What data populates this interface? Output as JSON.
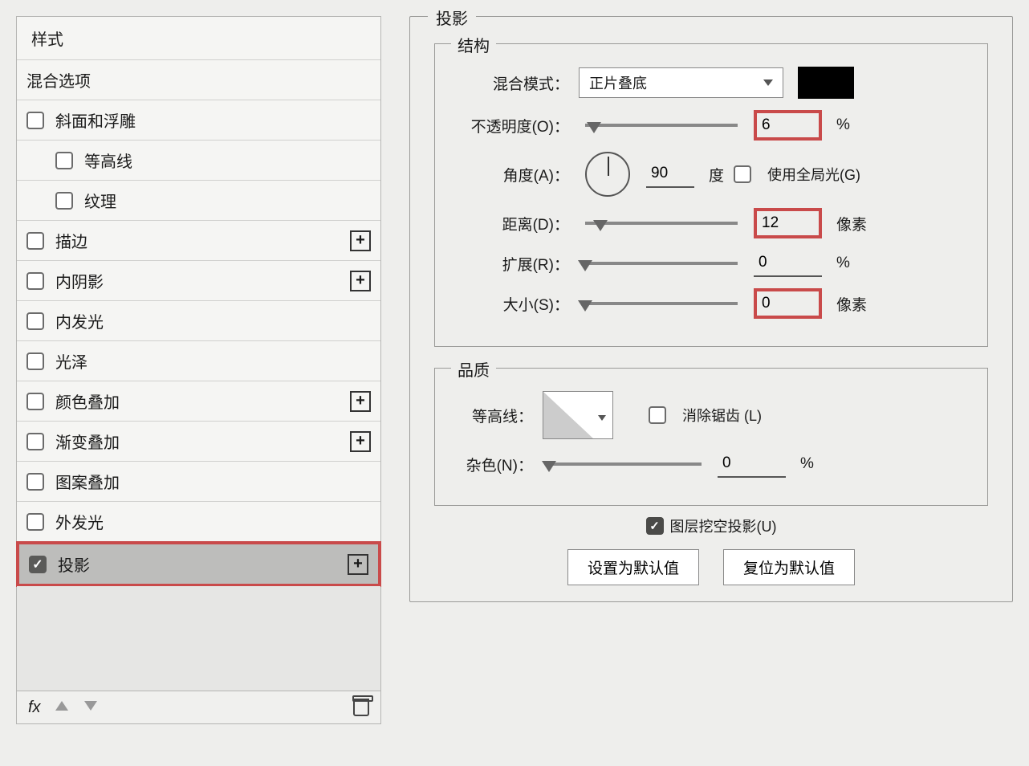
{
  "left": {
    "header": "样式",
    "blending_options": "混合选项",
    "items": [
      {
        "label": "斜面和浮雕",
        "checked": false,
        "hasPlus": false
      },
      {
        "label": "等高线",
        "checked": false,
        "hasPlus": false,
        "indent": true
      },
      {
        "label": "纹理",
        "checked": false,
        "hasPlus": false,
        "indent": true
      },
      {
        "label": "描边",
        "checked": false,
        "hasPlus": true
      },
      {
        "label": "内阴影",
        "checked": false,
        "hasPlus": true
      },
      {
        "label": "内发光",
        "checked": false,
        "hasPlus": false
      },
      {
        "label": "光泽",
        "checked": false,
        "hasPlus": false
      },
      {
        "label": "颜色叠加",
        "checked": false,
        "hasPlus": true
      },
      {
        "label": "渐变叠加",
        "checked": false,
        "hasPlus": true
      },
      {
        "label": "图案叠加",
        "checked": false,
        "hasPlus": false
      },
      {
        "label": "外发光",
        "checked": false,
        "hasPlus": false
      },
      {
        "label": "投影",
        "checked": true,
        "hasPlus": true,
        "selected": true
      }
    ],
    "fx": "fx"
  },
  "right": {
    "title": "投影",
    "structure": {
      "legend": "结构",
      "blend_mode_label": "混合模式：",
      "blend_mode_value": "正片叠底",
      "opacity_label": "不透明度(O)：",
      "opacity_value": "6",
      "opacity_unit": "%",
      "angle_label": "角度(A)：",
      "angle_value": "90",
      "angle_unit": "度",
      "global_light": "使用全局光(G)",
      "distance_label": "距离(D)：",
      "distance_value": "12",
      "distance_unit": "像素",
      "spread_label": "扩展(R)：",
      "spread_value": "0",
      "spread_unit": "%",
      "size_label": "大小(S)：",
      "size_value": "0",
      "size_unit": "像素"
    },
    "quality": {
      "legend": "品质",
      "contour_label": "等高线：",
      "antialias": "消除锯齿 (L)",
      "noise_label": "杂色(N)：",
      "noise_value": "0",
      "noise_unit": "%"
    },
    "knockout": "图层挖空投影(U)",
    "set_default": "设置为默认值",
    "reset_default": "复位为默认值"
  }
}
